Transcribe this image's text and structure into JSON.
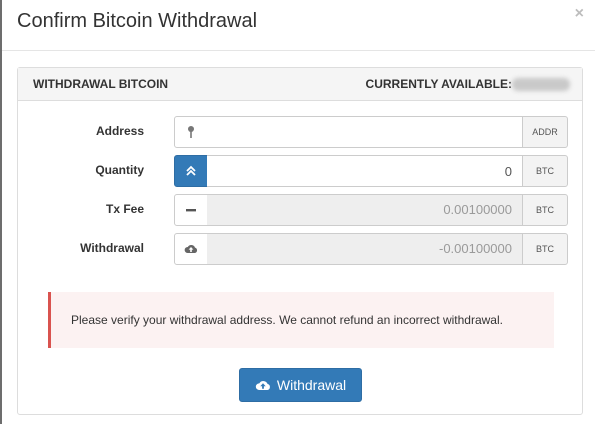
{
  "modal": {
    "title": "Confirm Bitcoin Withdrawal",
    "close_label": "×"
  },
  "panel": {
    "heading_left": "WITHDRAWAL BITCOIN",
    "heading_right": "CURRENTLY AVAILABLE:"
  },
  "form": {
    "address": {
      "label": "Address",
      "value": "",
      "suffix": "ADDR",
      "icon": "map-pin-icon"
    },
    "quantity": {
      "label": "Quantity",
      "value": "0",
      "suffix": "BTC",
      "icon": "chevron-up-icon"
    },
    "tx_fee": {
      "label": "Tx Fee",
      "value": "0.00100000",
      "suffix": "BTC",
      "icon": "minus-icon"
    },
    "withdrawal": {
      "label": "Withdrawal",
      "value": "-0.00100000",
      "suffix": "BTC",
      "icon": "cloud-upload-icon"
    }
  },
  "alert": {
    "text": "Please verify your withdrawal address. We cannot refund an incorrect withdrawal."
  },
  "submit": {
    "label": "Withdrawal",
    "icon": "cloud-upload-icon"
  },
  "colors": {
    "primary": "#337ab7",
    "danger": "#d9534f",
    "alert_bg": "#fcf2f2"
  }
}
